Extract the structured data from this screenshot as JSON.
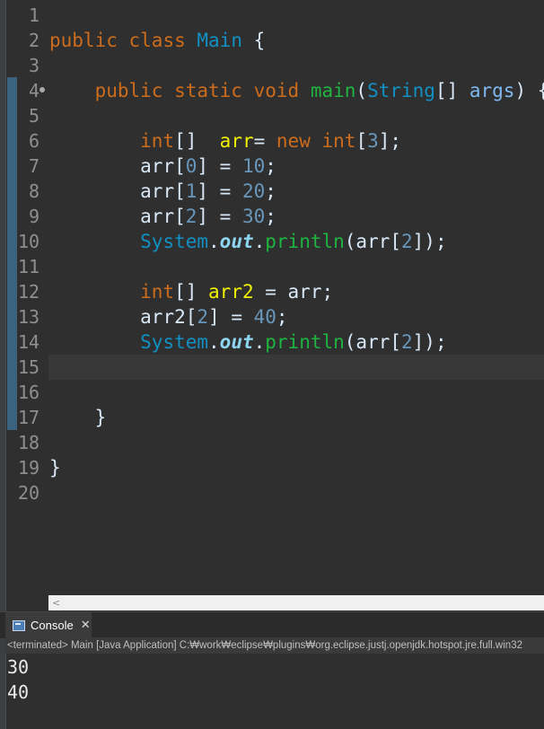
{
  "editor": {
    "lines": [
      {
        "n": "1",
        "tokens": []
      },
      {
        "n": "2",
        "tokens": [
          [
            "kw",
            "public"
          ],
          [
            "def",
            " "
          ],
          [
            "kw",
            "class"
          ],
          [
            "def",
            " "
          ],
          [
            "cls",
            "Main"
          ],
          [
            "def",
            " {"
          ]
        ]
      },
      {
        "n": "3",
        "tokens": []
      },
      {
        "n": "4",
        "fold": true,
        "tokens": [
          [
            "def",
            "    "
          ],
          [
            "kw",
            "public"
          ],
          [
            "def",
            " "
          ],
          [
            "kw",
            "static"
          ],
          [
            "def",
            " "
          ],
          [
            "kw",
            "void"
          ],
          [
            "def",
            " "
          ],
          [
            "m",
            "main"
          ],
          [
            "def",
            "("
          ],
          [
            "cls",
            "String"
          ],
          [
            "def",
            "[] "
          ],
          [
            "fld2",
            "args"
          ],
          [
            "def",
            ") {"
          ]
        ]
      },
      {
        "n": "5",
        "tokens": []
      },
      {
        "n": "6",
        "tokens": [
          [
            "def",
            "        "
          ],
          [
            "kw",
            "int"
          ],
          [
            "def",
            "[]  "
          ],
          [
            "var",
            "arr"
          ],
          [
            "def",
            "= "
          ],
          [
            "kw",
            "new"
          ],
          [
            "def",
            " "
          ],
          [
            "kw",
            "int"
          ],
          [
            "def",
            "["
          ],
          [
            "num",
            "3"
          ],
          [
            "def",
            "];"
          ]
        ]
      },
      {
        "n": "7",
        "tokens": [
          [
            "def",
            "        "
          ],
          [
            "def",
            "arr["
          ],
          [
            "num",
            "0"
          ],
          [
            "def",
            "] = "
          ],
          [
            "num",
            "10"
          ],
          [
            "def",
            ";"
          ]
        ]
      },
      {
        "n": "8",
        "tokens": [
          [
            "def",
            "        "
          ],
          [
            "def",
            "arr["
          ],
          [
            "num",
            "1"
          ],
          [
            "def",
            "] = "
          ],
          [
            "num",
            "20"
          ],
          [
            "def",
            ";"
          ]
        ]
      },
      {
        "n": "9",
        "tokens": [
          [
            "def",
            "        "
          ],
          [
            "def",
            "arr["
          ],
          [
            "num",
            "2"
          ],
          [
            "def",
            "] = "
          ],
          [
            "num",
            "30"
          ],
          [
            "def",
            ";"
          ]
        ]
      },
      {
        "n": "10",
        "tokens": [
          [
            "def",
            "        "
          ],
          [
            "cls",
            "System"
          ],
          [
            "def",
            "."
          ],
          [
            "fld",
            "out"
          ],
          [
            "def",
            "."
          ],
          [
            "m",
            "println"
          ],
          [
            "def",
            "(arr["
          ],
          [
            "num",
            "2"
          ],
          [
            "def",
            "]);"
          ]
        ]
      },
      {
        "n": "11",
        "tokens": []
      },
      {
        "n": "12",
        "tokens": [
          [
            "def",
            "        "
          ],
          [
            "kw",
            "int"
          ],
          [
            "def",
            "[] "
          ],
          [
            "var",
            "arr2"
          ],
          [
            "def",
            " = arr;"
          ]
        ]
      },
      {
        "n": "13",
        "tokens": [
          [
            "def",
            "        "
          ],
          [
            "def",
            "arr2["
          ],
          [
            "num",
            "2"
          ],
          [
            "def",
            "] = "
          ],
          [
            "num",
            "40"
          ],
          [
            "def",
            ";"
          ]
        ]
      },
      {
        "n": "14",
        "tokens": [
          [
            "def",
            "        "
          ],
          [
            "cls",
            "System"
          ],
          [
            "def",
            "."
          ],
          [
            "fld",
            "out"
          ],
          [
            "def",
            "."
          ],
          [
            "m",
            "println"
          ],
          [
            "def",
            "(arr["
          ],
          [
            "num",
            "2"
          ],
          [
            "def",
            "]);"
          ]
        ]
      },
      {
        "n": "15",
        "current": true,
        "tokens": []
      },
      {
        "n": "16",
        "tokens": []
      },
      {
        "n": "17",
        "tokens": [
          [
            "def",
            "    }"
          ]
        ]
      },
      {
        "n": "18",
        "tokens": []
      },
      {
        "n": "19",
        "tokens": [
          [
            "def",
            "}"
          ]
        ]
      },
      {
        "n": "20",
        "tokens": []
      }
    ],
    "scroll_arrow": "<"
  },
  "console": {
    "tab_label": "Console",
    "close_glyph": "✕",
    "status": "<terminated> Main [Java Application] C:₩work₩eclipse₩plugins₩org.eclipse.justj.openjdk.hotspot.jre.full.win32",
    "output": [
      "30",
      "40"
    ]
  },
  "colors": {
    "keyword": "#cc6c1d",
    "class": "#1290c3",
    "method": "#1eb540",
    "number": "#6897bb",
    "variable": "#f2f200",
    "field": "#8dd5f0",
    "background": "#2f2f2f"
  }
}
